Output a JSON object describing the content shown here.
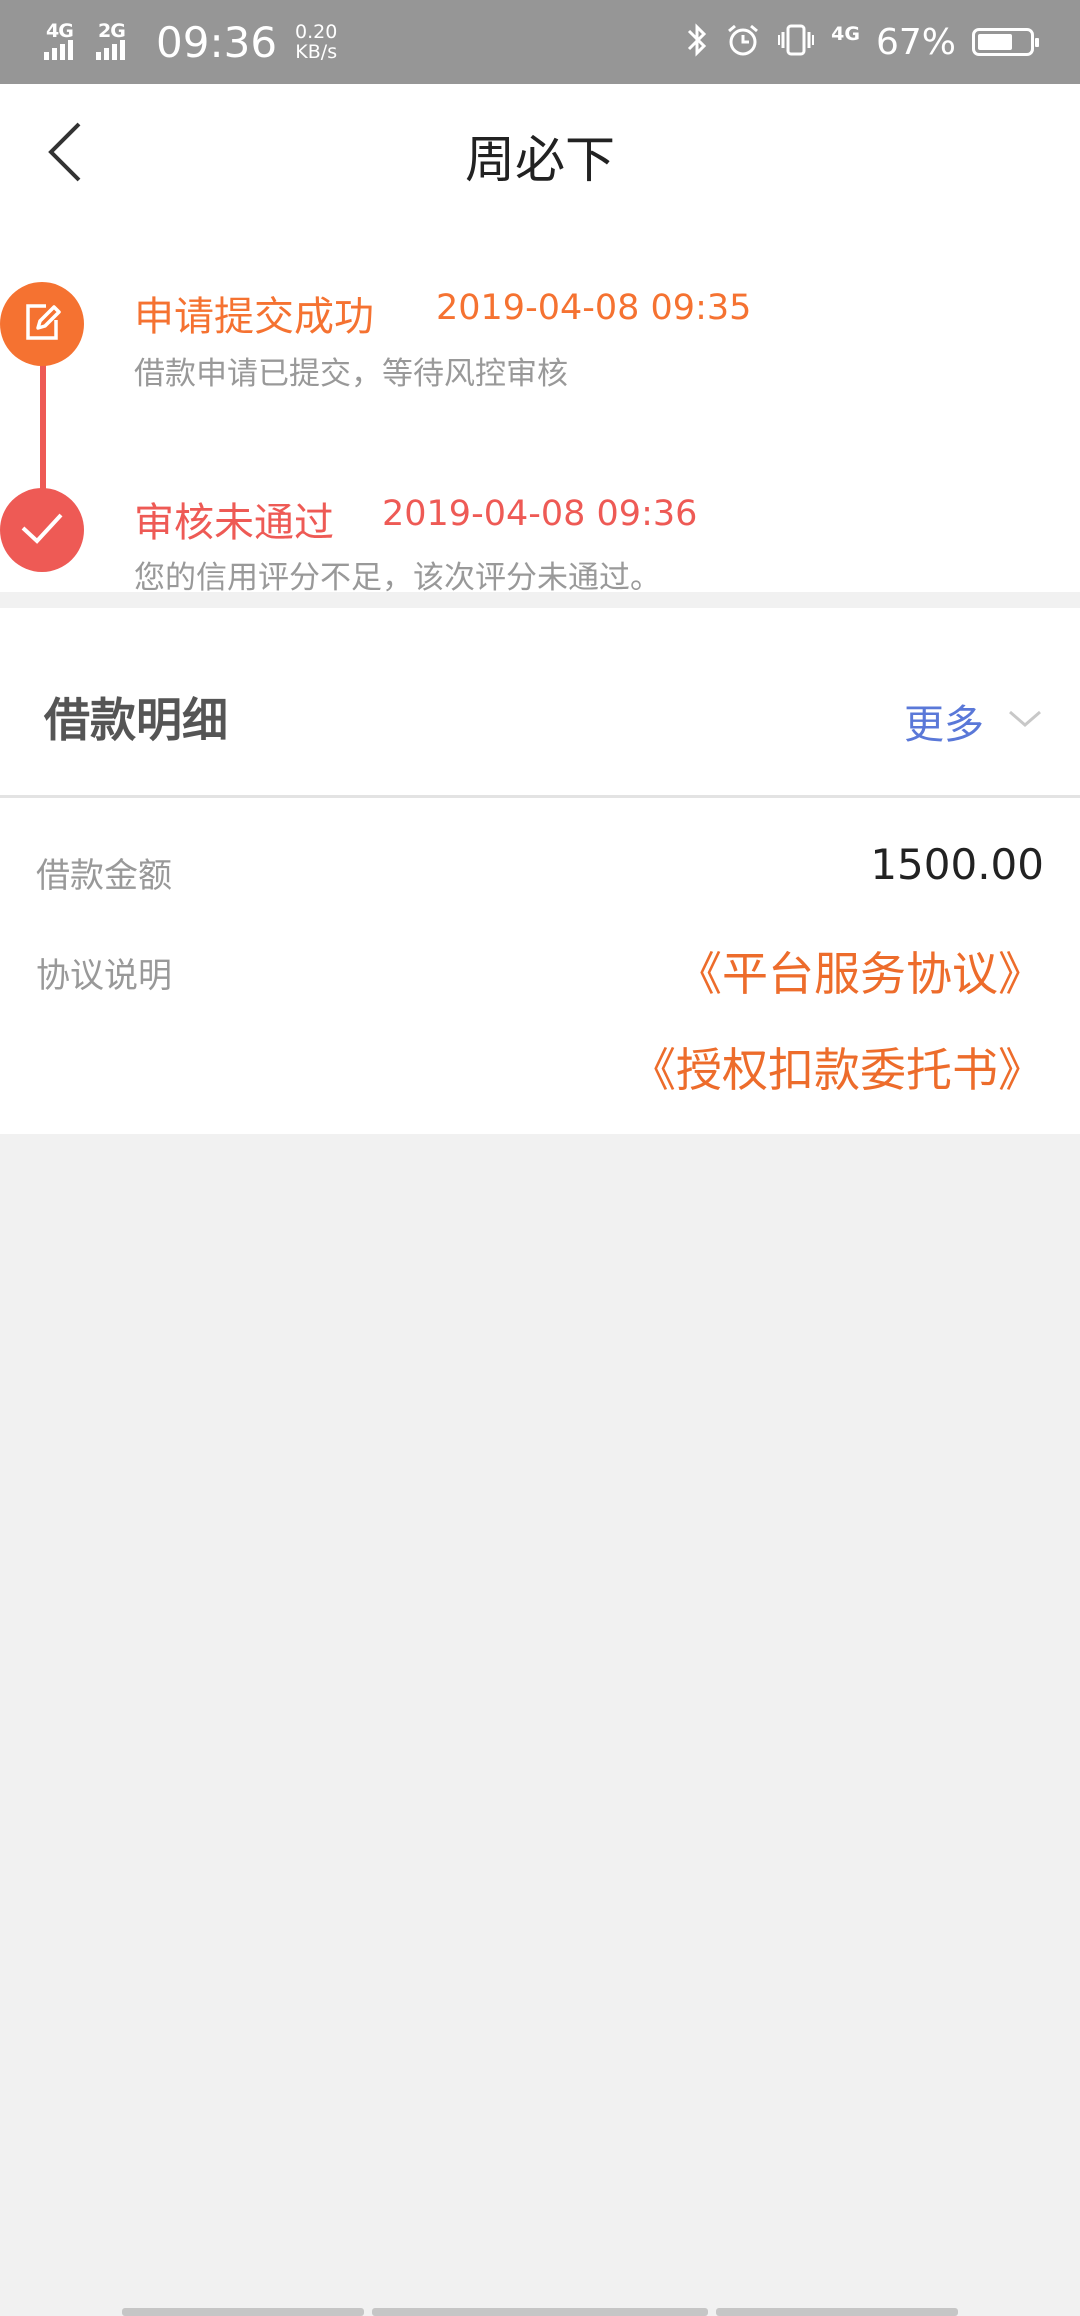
{
  "status_bar": {
    "net1": "4G",
    "net2": "2G",
    "time": "09:36",
    "speed_value": "0.20",
    "speed_unit": "KB/s",
    "net3": "4G",
    "battery_text": "67%",
    "battery_level": 0.67,
    "icons": [
      "bluetooth-icon",
      "alarm-icon",
      "vibrate-icon",
      "signal-4g-icon",
      "battery-icon"
    ]
  },
  "header": {
    "title": "周必下",
    "back_icon": "chevron-left-icon"
  },
  "timeline": {
    "steps": [
      {
        "title": "申请提交成功",
        "time": "2019-04-08 09:35",
        "desc": "借款申请已提交，等待风控审核",
        "icon": "edit-icon",
        "color": "#f57231"
      },
      {
        "title": "审核未通过",
        "time": "2019-04-08 09:36",
        "desc": "您的信用评分不足，该次评分未通过。",
        "icon": "check-icon",
        "color": "#ee5a55"
      }
    ],
    "line_color": "#ee5a55"
  },
  "detail": {
    "title": "借款明细",
    "more_label": "更多",
    "amount_label": "借款金额",
    "amount_value": "1500.00",
    "agreement_label": "协议说明",
    "links": [
      "《平台服务协议》",
      "《授权扣款委托书》"
    ]
  },
  "colors": {
    "accent": "#ed6c2b",
    "link_blue": "#5a78d8",
    "status_bar": "#969696",
    "background": "#f1f1f1"
  }
}
